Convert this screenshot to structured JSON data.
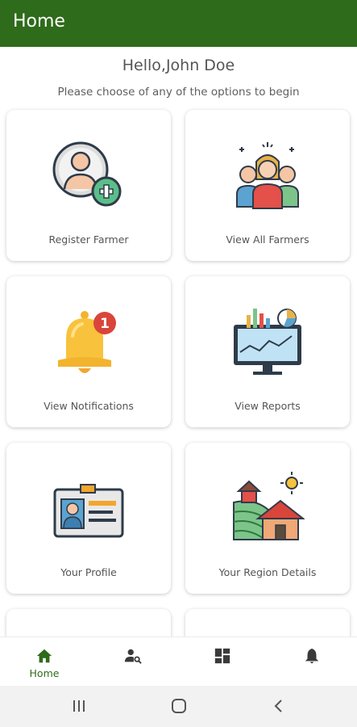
{
  "appbar": {
    "title": "Home"
  },
  "greeting": "Hello,John Doe",
  "subtitle": "Please choose of any of the options to begin",
  "cards": [
    {
      "label": "Register Farmer",
      "icon": "add-user-icon"
    },
    {
      "label": "View All Farmers",
      "icon": "farmers-group-icon"
    },
    {
      "label": "View Notifications",
      "icon": "notification-bell-icon",
      "badge": "1"
    },
    {
      "label": "View Reports",
      "icon": "reports-monitor-icon"
    },
    {
      "label": "Your Profile",
      "icon": "id-card-icon"
    },
    {
      "label": "Your Region Details",
      "icon": "farm-region-icon"
    }
  ],
  "bottom_nav": {
    "items": [
      {
        "label": "Home",
        "icon": "home-icon",
        "active": true
      },
      {
        "label": "",
        "icon": "user-search-icon"
      },
      {
        "label": "",
        "icon": "dashboard-icon"
      },
      {
        "label": "",
        "icon": "bell-icon"
      }
    ]
  },
  "colors": {
    "primary": "#2e6b1a",
    "card_bg": "#ffffff",
    "text": "#555555"
  }
}
